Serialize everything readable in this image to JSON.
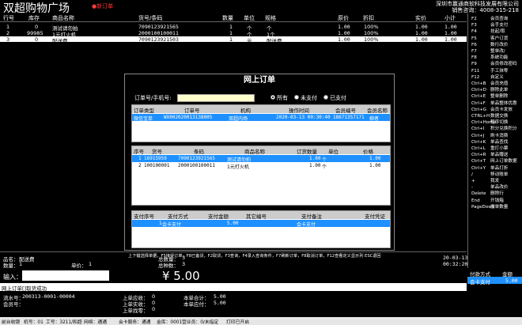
{
  "header": {
    "title": "双超购物广场",
    "new_order": "新订单",
    "company": "深圳市赢通商软科技发展有限公司",
    "sales_phone": "销售咨询：4008-315-218"
  },
  "table": {
    "headers": [
      "行号",
      "库存",
      "商品名称",
      "货号/条码",
      "数量",
      "单位",
      "规格",
      "原价",
      "折扣",
      "实价",
      "小计"
    ],
    "rows": [
      [
        "1",
        "0",
        "测试请勿拍",
        "7090123921565",
        "1",
        "个",
        "个",
        "1.00",
        "100%",
        "1.00",
        "1.00"
      ],
      [
        "2",
        "99985",
        "1元打火机",
        "2000100100011",
        "1",
        "个",
        "1个",
        "1.00",
        "100%",
        "1.00",
        "1.00"
      ],
      [
        "3",
        "0",
        "配送费",
        "7090123921503",
        "1",
        "元",
        "配送费",
        "1.00",
        "100%",
        "1.00",
        "1.00"
      ]
    ]
  },
  "shortcuts": [
    [
      "F2",
      "会员查询"
    ],
    [
      "F3",
      "会手支付"
    ],
    [
      "F4",
      "挂起/取"
    ],
    [
      "F5",
      "客户订货"
    ],
    [
      "F6",
      "数行改价"
    ],
    [
      "F7",
      "整单改/"
    ],
    [
      "F8",
      "系统功能"
    ],
    [
      "F9",
      "会员修改密码"
    ],
    [
      "F11",
      "手工抹零"
    ],
    [
      "F12",
      "自定义"
    ],
    [
      "Ctrl+B",
      "会员充值"
    ],
    [
      "Ctrl+D",
      "删除此单"
    ],
    [
      "Ctrl+E",
      "整单删除"
    ],
    [
      "Ctrl+F",
      "单品整体优惠"
    ],
    [
      "Ctrl+G",
      "会员卡发放"
    ],
    [
      "CTRL+H",
      "数据交换"
    ],
    [
      "Ctrl+Home",
      "程序切换"
    ],
    [
      "Ctrl+I",
      "积分兑换积分"
    ],
    [
      "Ctrl+J",
      "刷卡消费"
    ],
    [
      "Ctrl+K",
      "单品查找"
    ],
    [
      "Ctrl+L",
      "重打小票"
    ],
    [
      "Ctrl+R",
      "单品赠送"
    ],
    [
      "Ctrl+T",
      "网上订单数据"
    ],
    [
      "Ctrl+Y",
      "单品打折"
    ],
    [
      "/",
      "移动账单"
    ],
    [
      "+",
      "我发"
    ],
    [
      "-",
      "单品改价"
    ],
    [
      "Delete",
      "删除行"
    ],
    [
      "End",
      "开钱箱"
    ],
    [
      "PageDown",
      "搜单数量"
    ]
  ],
  "dialog": {
    "title": "网上订单",
    "order_label": "订单号/手机号:",
    "order_value": "",
    "radios": [
      {
        "label": "所有",
        "checked": true
      },
      {
        "label": "未支付",
        "checked": false
      },
      {
        "label": "已支付",
        "checked": false
      }
    ],
    "orders": {
      "headers": [
        "订单类型",
        "订单号",
        "机构",
        "操作时间",
        "会员编号",
        "会员名称"
      ],
      "rows": [
        [
          "微信宝单",
          "WX002020013138005",
          "双超内场",
          "2020-03-13 00:30:40",
          "18671357171",
          "柳者"
        ]
      ]
    },
    "items": {
      "headers": [
        "序号",
        "货号",
        "条码",
        "商品名称",
        "订货数量",
        "单位",
        "价格"
      ],
      "rows": [
        [
          "1",
          "16915959",
          "7090123921565",
          "测试请勿拍",
          "1.00",
          "个",
          "1.00"
        ],
        [
          "2",
          "100100001",
          "2000100100011",
          "1元打火机",
          "1.00",
          "个",
          "1.00"
        ]
      ]
    },
    "payments": {
      "headers": [
        "支付序号",
        "支付方式",
        "支付金额",
        "其它编号",
        "支付备注",
        "支付凭证"
      ],
      "rows": [
        [
          "1",
          "会卡支付",
          "5.00",
          "",
          "会卡支付",
          ""
        ]
      ]
    },
    "hint": "上下键选择单据，F5接受订单，F8已备货，F2取货，F3查询，F4录入查询条件，F7刷新订单，F8取消订单，F12查看定义显示列 ESC退回"
  },
  "summary": {
    "item_name_label": "品名：",
    "item_name": "配送费",
    "qty_label": "数量：",
    "qty": "1",
    "unit_price_label": "单价：",
    "unit_price": "1",
    "total_qty_label": "总数量：",
    "total_qty": "3",
    "total_items_label": "总种数：",
    "total_items": "3",
    "date": "20-03-13",
    "time": "00:32:20"
  },
  "input": {
    "label": "输入：",
    "value": "",
    "amount": "¥ 5.00"
  },
  "message": "网上订单[]取货成功",
  "bottom_info": {
    "serial_label": "流水号：",
    "serial": "200313-0001-00004",
    "member_label": "会员号：",
    "member": "",
    "last_receivable_label": "上单应收：",
    "last_receivable": "0",
    "last_paid_label": "上单实收：",
    "last_paid": "0",
    "last_change_label": "上单找零：",
    "last_change": "0",
    "total_label": "本单合计：",
    "total": "5.00",
    "payable_label": "本单应付：",
    "payable": "5.00"
  },
  "payment_panel": {
    "headers": [
      "付款方式",
      "金额"
    ],
    "rows": [
      [
        "会卡支付",
        "5.00"
      ]
    ]
  },
  "status_bar": [
    "前台收银",
    "机号：01",
    "工号：3211/和超",
    "网络：通通",
    "会卡服务：通通",
    "金库：0001",
    "营业员：0/未指定",
    "打印已开启"
  ],
  "colors": {
    "selection": "#1e90ff",
    "input_bg": "#ffffcc",
    "alert": "#ff3a3a"
  }
}
